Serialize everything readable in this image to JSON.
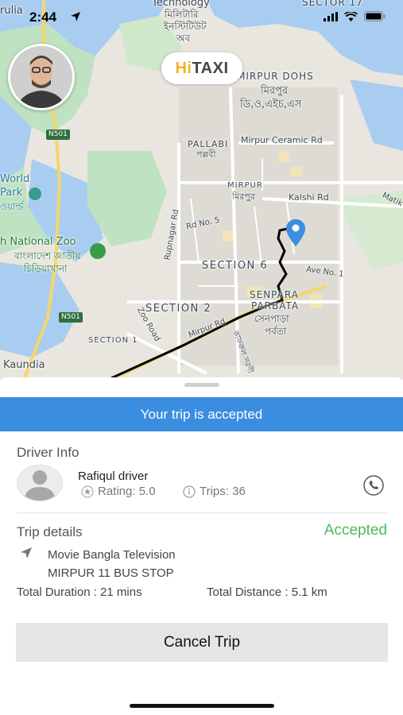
{
  "status_bar": {
    "time": "2:44"
  },
  "map": {
    "logo_hi": "Hi",
    "logo_taxi": "TAXI",
    "labels": {
      "technology": "Technology",
      "militari": "মিলিটারি",
      "institute": "ইনস্টিটিউট",
      "of": "অব",
      "sector17": "SECTOR 17",
      "mirpur_dohs": "MIRPUR DOHS",
      "mirpur_bn": "মিরপুর",
      "dohs_bn": "ডি,ও,এইচ,এস",
      "pallabi": "PALLABI",
      "pallabi_bn": "পল্লবী",
      "mirpur_ceramic": "Mirpur Ceramic Rd",
      "n501": "N501",
      "n501b": "N501",
      "rulia": "rulia",
      "world_park": "World",
      "park": "Park",
      "park_bn": "ওয়ার্ল্ড",
      "mirpur2": "MIRPUR",
      "mirpur2_bn": "মিরপুর",
      "kalshi": "Kalshi Rd",
      "matik": "Matik",
      "rd5": "Rd No. 5",
      "rupnagar": "Rupnagar Rd",
      "national_zoo": "h National Zoo",
      "zoo_bn1": "বাংলাদেশ জাতীয়",
      "zoo_bn2": "চিড়িয়াখানা",
      "section6": "SECTION 6",
      "ave1": "Ave No. 1",
      "senpara": "SENPARA",
      "parbata": "PARBATA",
      "senpara_bn": "সেনপাড়া",
      "parbata_bn": "পর্বতা",
      "section2": "SECTION 2",
      "zoo_road": "Zoo Road",
      "mirpur_rd": "Mirpur Rd",
      "section1": "SECTION 1",
      "kaundia": "Kaundia",
      "bn_road": "কাফরুল সরণী"
    }
  },
  "sheet": {
    "banner": "Your trip is accepted",
    "driver_info_title": "Driver Info",
    "driver_name": "Rafiqul driver",
    "rating": "Rating: 5.0",
    "trips": "Trips: 36",
    "trip_details_title": "Trip details",
    "trip_status": "Accepted",
    "pickup": "Movie Bangla Television",
    "dropoff": "MIRPUR 11 BUS STOP",
    "duration": "Total Duration : 21 mins",
    "distance": "Total Distance : 5.1 km",
    "cancel_label": "Cancel Trip"
  },
  "colors": {
    "accent_blue": "#3b8de0",
    "accepted_green": "#4cbb5e",
    "pin_blue": "#3b8de0"
  },
  "icons": [
    "location-arrow-icon",
    "signal-icon",
    "wifi-icon",
    "battery-icon",
    "map-pin-icon",
    "star-icon",
    "info-icon",
    "phone-icon",
    "navigation-icon",
    "user-placeholder-icon"
  ]
}
